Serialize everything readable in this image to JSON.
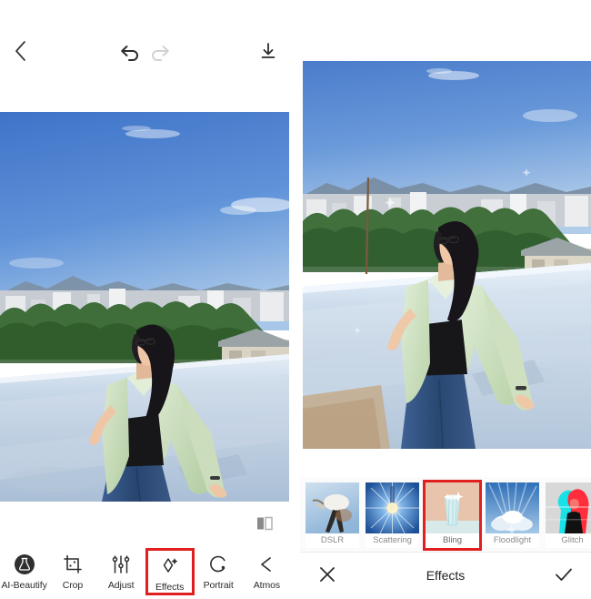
{
  "app": {
    "editor_title": "Effects"
  },
  "left_panel": {
    "toolbar": {
      "back_label": "Back",
      "undo_label": "Undo",
      "redo_label": "Redo",
      "save_label": "Save"
    },
    "compare_label": "Compare",
    "photo": {
      "alt": "Young woman in mint green shirt and blue jeans standing on a rooftop terrace against a blue sky",
      "sky_color": "#4a82d0",
      "wall_color": "#cfdcea",
      "jacket_color": "#c9dcbe",
      "jeans_color": "#2f4d7c"
    },
    "tools": [
      {
        "label": "AI-Beautify",
        "icon": "flask-icon",
        "selected": false
      },
      {
        "label": "Crop",
        "icon": "crop-icon",
        "selected": false
      },
      {
        "label": "Adjust",
        "icon": "sliders-icon",
        "selected": false
      },
      {
        "label": "Effects",
        "icon": "sparkle-icon",
        "selected": true
      },
      {
        "label": "Portrait",
        "icon": "portrait-icon",
        "selected": false
      },
      {
        "label": "Atmos",
        "icon": "chevron-left-icon",
        "selected": false
      }
    ]
  },
  "right_panel": {
    "photo": {
      "alt": "Same rooftop portrait with Bling effect applied",
      "sky_color": "#5b86c9",
      "wall_color": "#d5e1ee"
    },
    "effects": [
      {
        "label": "DSLR",
        "icon": "dslr-thumb",
        "selected": false
      },
      {
        "label": "Scattering",
        "icon": "scattering-thumb",
        "selected": false
      },
      {
        "label": "Bling",
        "icon": "bling-thumb",
        "selected": true
      },
      {
        "label": "Floodlight",
        "icon": "floodlight-thumb",
        "selected": false
      },
      {
        "label": "Glitch",
        "icon": "glitch-thumb",
        "selected": false
      },
      {
        "label": "",
        "icon": "partial-thumb",
        "selected": false
      }
    ],
    "bottom_bar": {
      "cancel_label": "Cancel",
      "title": "Effects",
      "confirm_label": "Apply"
    }
  },
  "colors": {
    "accent_highlight": "#e02020",
    "text_primary": "#2b2b2b",
    "text_muted": "#8b8b8b",
    "background": "#ffffff"
  }
}
